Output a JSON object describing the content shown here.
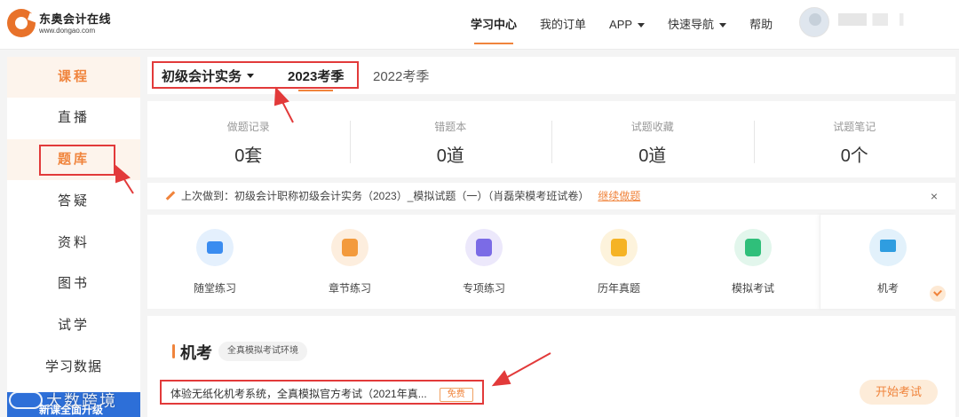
{
  "header": {
    "logo_cn": "东奥会计在线",
    "logo_en": "www.dongao.com",
    "nav": [
      {
        "label": "学习中心",
        "active": true,
        "dropdown": false
      },
      {
        "label": "我的订单",
        "active": false,
        "dropdown": false
      },
      {
        "label": "APP",
        "active": false,
        "dropdown": true
      },
      {
        "label": "快速导航",
        "active": false,
        "dropdown": true
      },
      {
        "label": "帮助",
        "active": false,
        "dropdown": false
      }
    ]
  },
  "sidebar": {
    "items": [
      {
        "label": "课程"
      },
      {
        "label": "直播"
      },
      {
        "label": "题库"
      },
      {
        "label": "答疑"
      },
      {
        "label": "资料"
      },
      {
        "label": "图书"
      },
      {
        "label": "试学"
      },
      {
        "label": "学习数据"
      }
    ],
    "banner": "新课全面升级"
  },
  "watermark": "大数跨境",
  "main": {
    "subject": "初级会计实务",
    "seasons": [
      "2023考季",
      "2022考季"
    ],
    "stats": [
      {
        "label": "做题记录",
        "value": "0套"
      },
      {
        "label": "错题本",
        "value": "0道"
      },
      {
        "label": "试题收藏",
        "value": "0道"
      },
      {
        "label": "试题笔记",
        "value": "0个"
      }
    ],
    "last": {
      "text": "上次做到：初级会计职称初级会计实务（2023）_模拟试题（一）（肖磊荣模考班试卷）",
      "link": "继续做题",
      "close": "×"
    },
    "features": [
      {
        "label": "随堂练习",
        "icon": "video-icon",
        "bg": "#e4f0fd",
        "fg": "#3a8cf0"
      },
      {
        "label": "章节练习",
        "icon": "book-icon",
        "bg": "#fdeede",
        "fg": "#f39a3c"
      },
      {
        "label": "专项练习",
        "icon": "checklist-icon",
        "bg": "#ece8fb",
        "fg": "#7b6be6"
      },
      {
        "label": "历年真题",
        "icon": "star-icon",
        "bg": "#fdf3dc",
        "fg": "#f5b325"
      },
      {
        "label": "模拟考试",
        "icon": "exam-icon",
        "bg": "#e2f6ec",
        "fg": "#2fbf7a"
      },
      {
        "label": "机考",
        "icon": "monitor-icon",
        "bg": "#e2f1fb",
        "fg": "#2f9de0"
      }
    ],
    "section": {
      "title": "机考",
      "tag": "全真模拟考试环境",
      "exam_text": "体验无纸化机考系统，全真模拟官方考试（2021年真...",
      "free": "免费",
      "start": "开始考试"
    }
  },
  "colors": {
    "accent": "#f0843c",
    "annotation": "#e23a3a"
  }
}
